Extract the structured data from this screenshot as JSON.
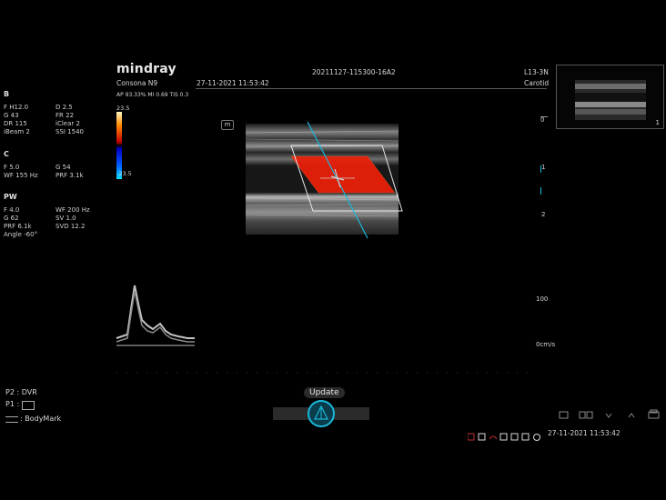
{
  "header": {
    "brand": "mindray",
    "model": "Consona N9",
    "datetime": "27-11-2021  11:53:42",
    "exam_id": "20211127-115300-16A2",
    "probe": "L13-3N",
    "preset": "Carotid",
    "safety": "AP 93.33%  MI 0.69 TIS 0.3"
  },
  "modes": {
    "b": {
      "title": "B",
      "rows": [
        [
          "F H12.0",
          "D 2.5"
        ],
        [
          "G 43",
          "FR 22"
        ],
        [
          "DR 115",
          "iClear 2"
        ],
        [
          "iBeam 2",
          "SSI 1540"
        ]
      ]
    },
    "c": {
      "title": "C",
      "rows": [
        [
          "F 5.0",
          "G 54"
        ],
        [
          "WF 155 Hz",
          "PRF 3.1k"
        ]
      ]
    },
    "pw": {
      "title": "PW",
      "rows": [
        [
          "F 4.0",
          "WF 200 Hz"
        ],
        [
          "G 62",
          "SV 1.0"
        ],
        [
          "PRF 6.1k",
          "SVD 12.2"
        ],
        [
          "Angle   -60°",
          ""
        ]
      ]
    }
  },
  "color_bar": {
    "max": "23.5",
    "min": "-23.5"
  },
  "image": {
    "m_label": "m",
    "depth_ticks": [
      "0",
      "1",
      "2"
    ],
    "velocity_ticks": [
      "100",
      "0cm/s"
    ]
  },
  "thumbnail": {
    "label": "1"
  },
  "bottom_left": {
    "p2": "P2 : DVR",
    "p1": "P1 :",
    "bodymark": ": BodyMark"
  },
  "update": {
    "label": "Update"
  },
  "status_bar": {
    "datetime": "27-11-2021  11:53:42"
  },
  "colors": {
    "accent": "#19b8d8",
    "doppler_red": "#e8200a",
    "background": "#000000"
  }
}
